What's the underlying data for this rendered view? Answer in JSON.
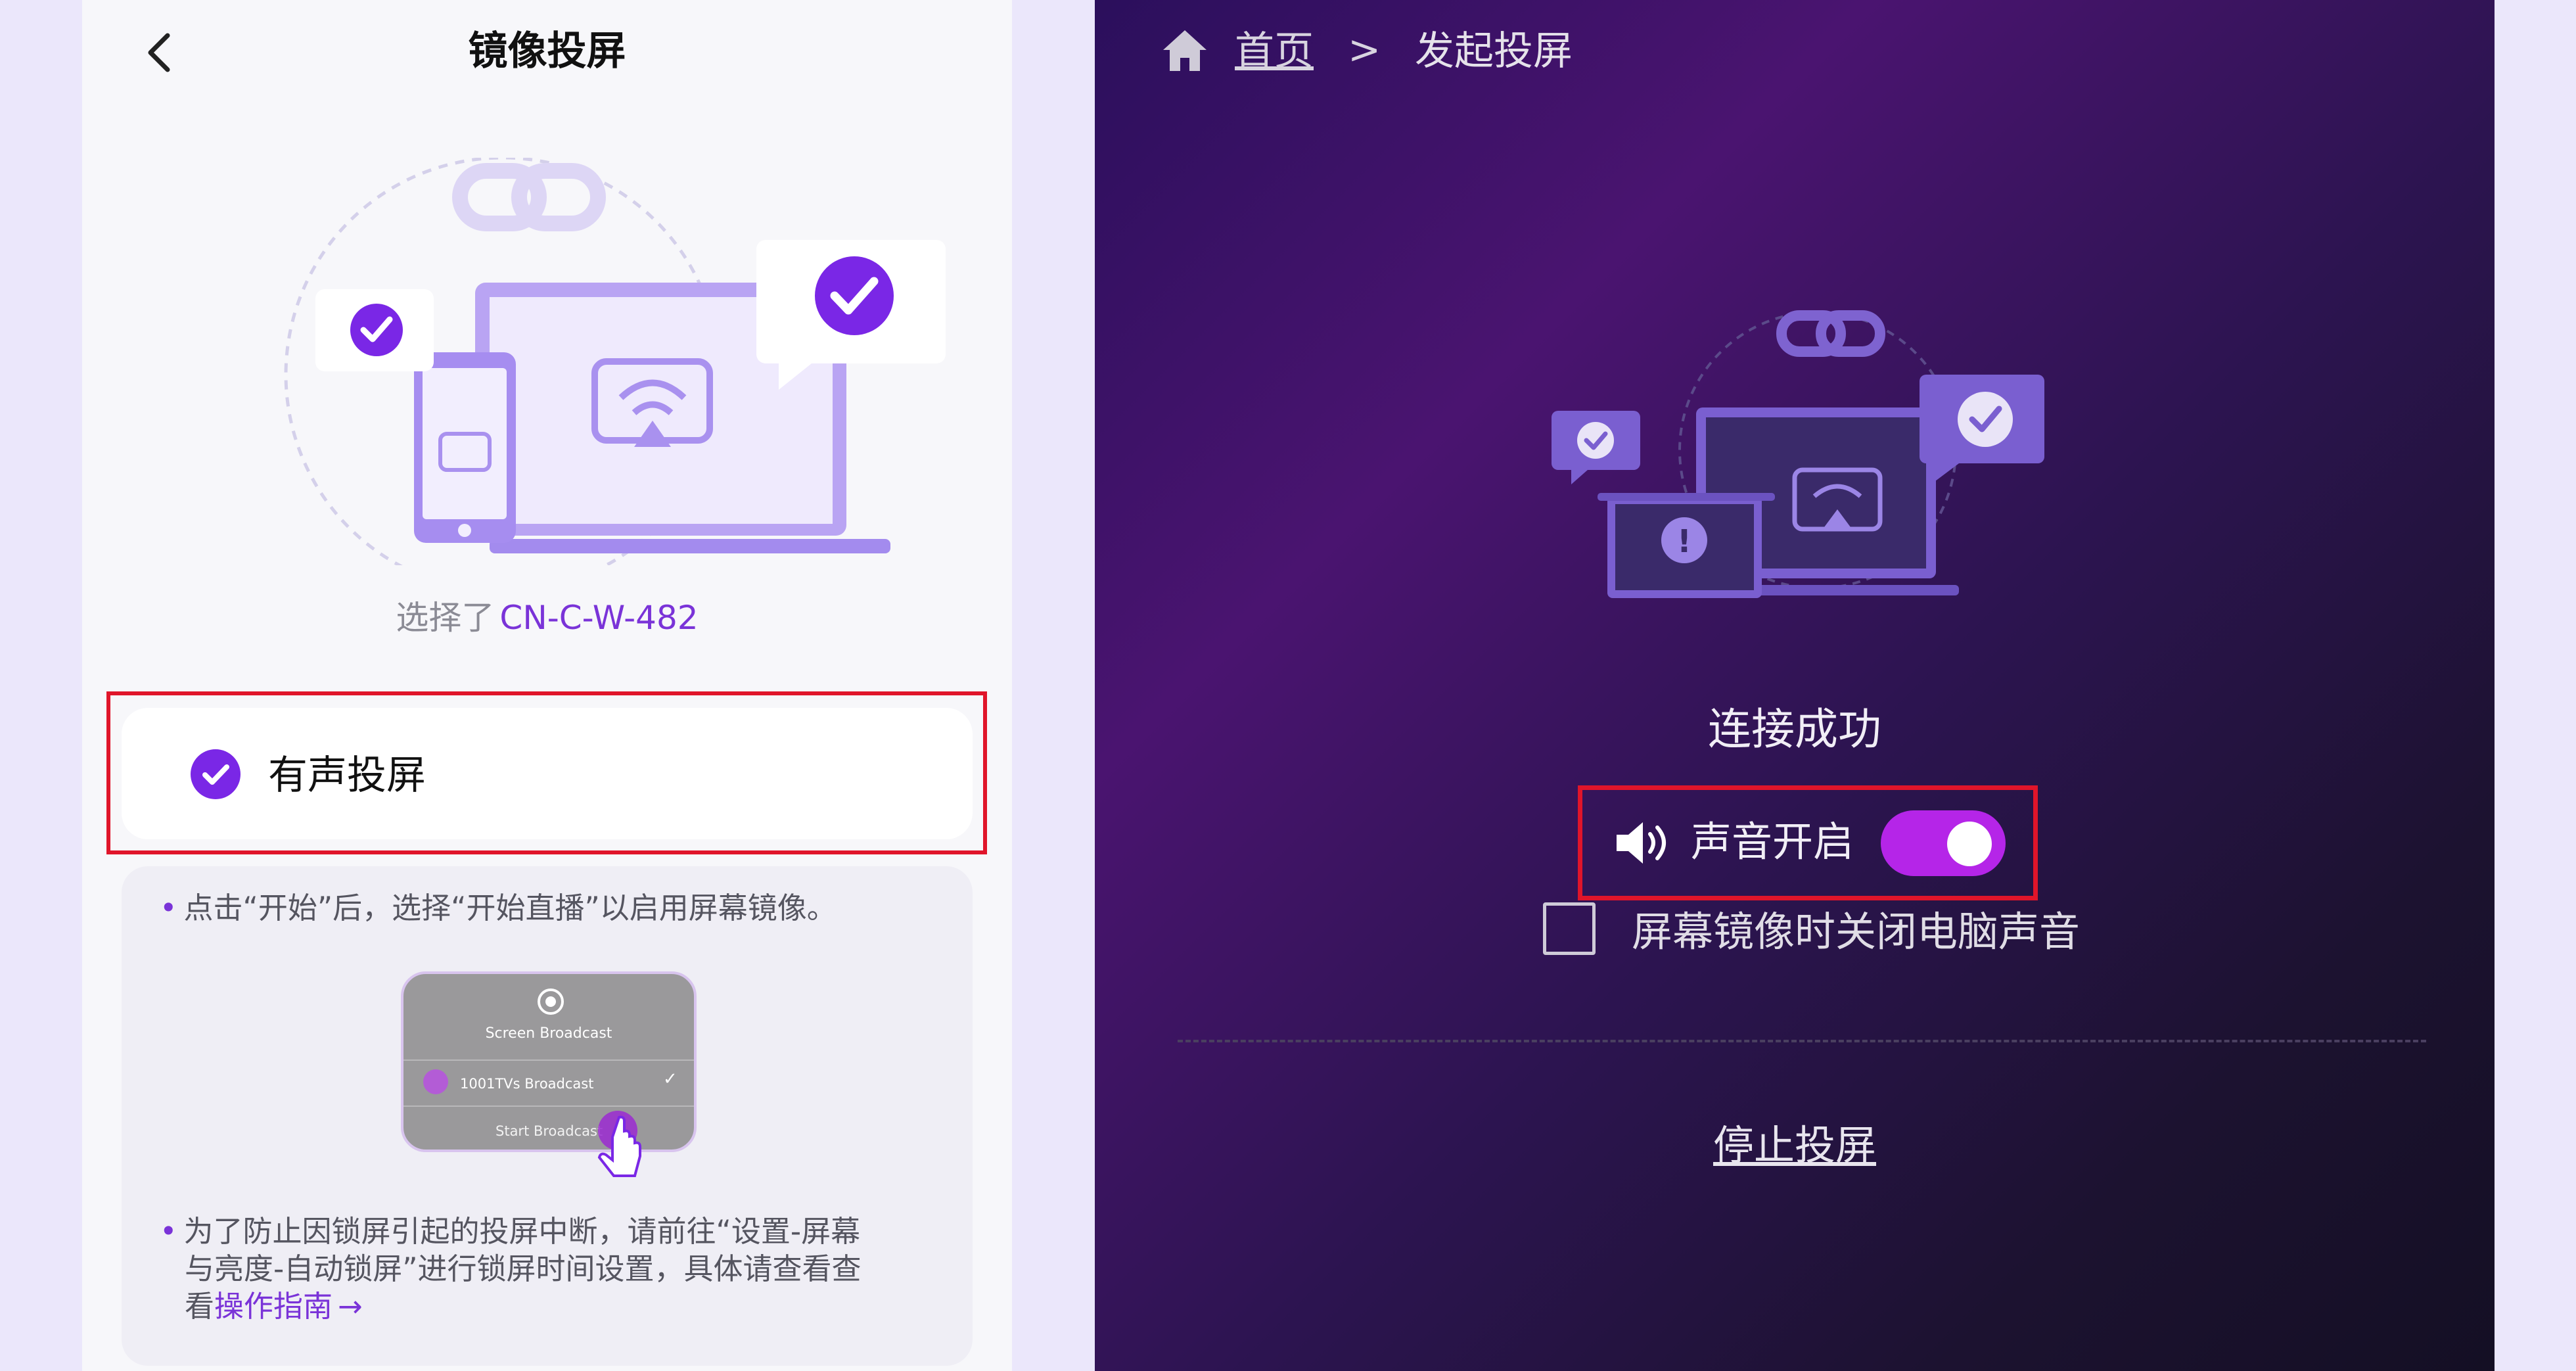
{
  "phone": {
    "title": "镜像投屏",
    "selected_prefix": "选择了",
    "selected_device": "CN-C-W-482",
    "sound_option_label": "有声投屏",
    "tip1": "点击“开始”后，选择“开始直播”以启用屏幕镜像。",
    "ios_dialog": {
      "title": "Screen Broadcast",
      "app_row": "1001TVs Broadcast",
      "start_label": "Start Broadcast"
    },
    "tip2_line1": "为了防止因锁屏引起的投屏中断，请前往“设置-屏幕",
    "tip2_line2": "与亮度-自动锁屏”进行锁屏时间设置，具体请查看查",
    "tip2_line3_prefix": "看",
    "tip2_link": "操作指南",
    "tip2_link_arrow": "→"
  },
  "tv": {
    "breadcrumb_home": "首页",
    "breadcrumb_sep": ">",
    "breadcrumb_current": "发起投屏",
    "status_text": "连接成功",
    "sound_toggle_label": "声音开启",
    "sound_toggle_on": true,
    "mute_checkbox_label": "屏幕镜像时关闭电脑声音",
    "mute_checkbox_checked": false,
    "stop_button_label": "停止投屏"
  },
  "colors": {
    "accent_purple": "#7a27e6",
    "toggle_on": "#b525e8",
    "highlight_red": "#e0152a"
  }
}
